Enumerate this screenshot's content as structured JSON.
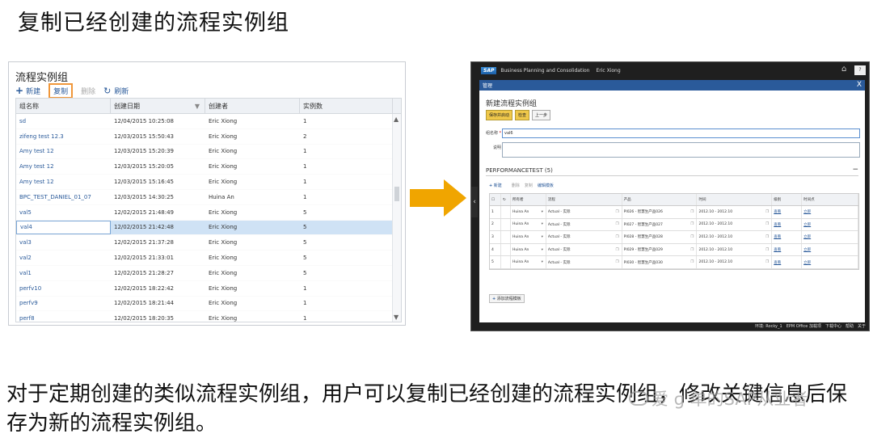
{
  "slide": {
    "title": "复制已经创建的流程实例组",
    "caption": "对于定期创建的类似流程实例组，用户可以复制已经创建的流程实例组，修改关键信息后保存为新的流程实例组。",
    "watermark": "爱 ɡ 单的SAP从业者"
  },
  "left": {
    "title": "流程实例组",
    "toolbar": {
      "new": "新建",
      "copy": "复制",
      "delete": "删除",
      "refresh": "刷新"
    },
    "columns": [
      "组名称",
      "创建日期",
      "创建者",
      "实例数"
    ],
    "rows": [
      {
        "name": "sd",
        "date": "12/04/2015 10:25:08",
        "by": "Eric Xiong",
        "count": "1"
      },
      {
        "name": "zifeng test 12.3",
        "date": "12/03/2015 15:50:43",
        "by": "Eric Xiong",
        "count": "2"
      },
      {
        "name": "Amy test 12",
        "date": "12/03/2015 15:20:39",
        "by": "Eric Xiong",
        "count": "1"
      },
      {
        "name": "Amy test 12",
        "date": "12/03/2015 15:20:05",
        "by": "Eric Xiong",
        "count": "1"
      },
      {
        "name": "Amy test 12",
        "date": "12/03/2015 15:16:45",
        "by": "Eric Xiong",
        "count": "1"
      },
      {
        "name": "BPC_TEST_DANIEL_01_07",
        "date": "12/03/2015 14:30:25",
        "by": "Huina An",
        "count": "1"
      },
      {
        "name": "val5",
        "date": "12/02/2015 21:48:49",
        "by": "Eric Xiong",
        "count": "5"
      },
      {
        "name": "val4",
        "date": "12/02/2015 21:42:48",
        "by": "Eric Xiong",
        "count": "5"
      },
      {
        "name": "val3",
        "date": "12/02/2015 21:37:28",
        "by": "Eric Xiong",
        "count": "5"
      },
      {
        "name": "val2",
        "date": "12/02/2015 21:33:01",
        "by": "Eric Xiong",
        "count": "5"
      },
      {
        "name": "val1",
        "date": "12/02/2015 21:28:27",
        "by": "Eric Xiong",
        "count": "5"
      },
      {
        "name": "perfv10",
        "date": "12/02/2015 18:22:42",
        "by": "Eric Xiong",
        "count": "1"
      },
      {
        "name": "perfv9",
        "date": "12/02/2015 18:21:44",
        "by": "Eric Xiong",
        "count": "1"
      },
      {
        "name": "perf8",
        "date": "12/02/2015 18:20:35",
        "by": "Eric Xiong",
        "count": "1"
      }
    ],
    "selected_row": 7
  },
  "right": {
    "app_title": "Business Planning and Consolidation",
    "user": "Eric Xiong",
    "help": "?",
    "dialog_header": "管理",
    "dialog_title": "新建流程实例组",
    "buttons": [
      "保存并启动",
      "检查",
      "上一步"
    ],
    "name_label": "组名称",
    "name_required": "*",
    "name_value": "val6",
    "desc_label": "说明",
    "section": "PERFORMANCETEST (5)",
    "table_toolbar": {
      "new": "新建",
      "delete": "删除",
      "copy": "复制",
      "edit_template": "编辑模板"
    },
    "columns": [
      "所有者",
      "流程",
      "产品",
      "时间",
      "级别",
      "时间点"
    ],
    "rows": [
      {
        "n": "1",
        "owner": "Huina An",
        "flow": "Actual - 实际",
        "product": "PI026 - 智慧生产品026",
        "time": "2012.10 - 2012.10",
        "level": "查看",
        "point": "立即"
      },
      {
        "n": "2",
        "owner": "Huina An",
        "flow": "Actual - 实际",
        "product": "PI027 - 智慧生产品027",
        "time": "2012.10 - 2012.10",
        "level": "查看",
        "point": "立即"
      },
      {
        "n": "3",
        "owner": "Huina An",
        "flow": "Actual - 实际",
        "product": "PI028 - 智慧生产品028",
        "time": "2012.10 - 2012.10",
        "level": "查看",
        "point": "立即"
      },
      {
        "n": "4",
        "owner": "Huina An",
        "flow": "Actual - 实际",
        "product": "PI029 - 智慧生产品029",
        "time": "2012.10 - 2012.10",
        "level": "查看",
        "point": "立即"
      },
      {
        "n": "5",
        "owner": "Huina An",
        "flow": "Actual - 实际",
        "product": "PI030 - 智慧生产品030",
        "time": "2012.10 - 2012.10",
        "level": "查看",
        "point": "立即"
      }
    ],
    "add_line": "添加流程模板",
    "status": [
      "环境: Rocky_1",
      "EPM Office 加载项",
      "下载中心",
      "帮助",
      "关于"
    ]
  },
  "colors": {
    "accent_orange": "#f0a500",
    "highlight": "#f0973a",
    "sap_blue": "#2a5a9a"
  }
}
